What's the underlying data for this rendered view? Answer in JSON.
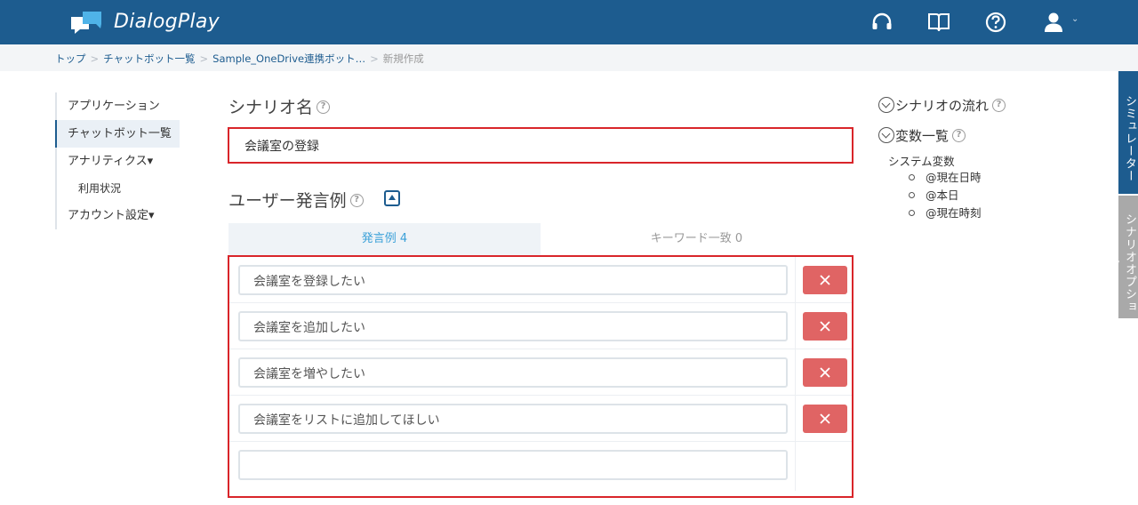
{
  "header": {
    "app_title": "DialogPlay",
    "icons": [
      "headset-icon",
      "book-icon",
      "help-icon",
      "user-icon"
    ],
    "bg_color": "#1d5c8f"
  },
  "breadcrumb": {
    "items": [
      "トップ",
      "チャットボット一覧",
      "Sample_OneDrive連携ボット…"
    ],
    "current": "新規作成"
  },
  "sidebar": {
    "items": [
      {
        "label": "アプリケーション"
      },
      {
        "label": "チャットボット一覧"
      },
      {
        "label": "アナリティクス▾"
      },
      {
        "label": "利用状況"
      },
      {
        "label": "アカウント設定▾"
      }
    ]
  },
  "scenario": {
    "name_label": "シナリオ名",
    "name_value": "会議室の登録"
  },
  "examples": {
    "label": "ユーザー発言例",
    "tabs": [
      {
        "label": "発言例 4"
      },
      {
        "label": "キーワード一致 0"
      }
    ],
    "items": [
      "会議室を登録したい",
      "会議室を追加したい",
      "会議室を増やしたい",
      "会議室をリストに追加してほしい"
    ],
    "new_item_value": ""
  },
  "right_panel": {
    "flow_label": "シナリオの流れ",
    "vars_label": "変数一覧",
    "system_vars_label": "システム変数",
    "system_vars": [
      "@現在日時",
      "@本日",
      "@現在時刻"
    ]
  },
  "side_tabs": [
    "シミュレーター",
    "シナリオオプション"
  ],
  "colors": {
    "accent": "#1d5c8f",
    "highlight_border": "#d9252a",
    "delete_button": "#e06464",
    "active_tab_text": "#3aa0d8"
  }
}
